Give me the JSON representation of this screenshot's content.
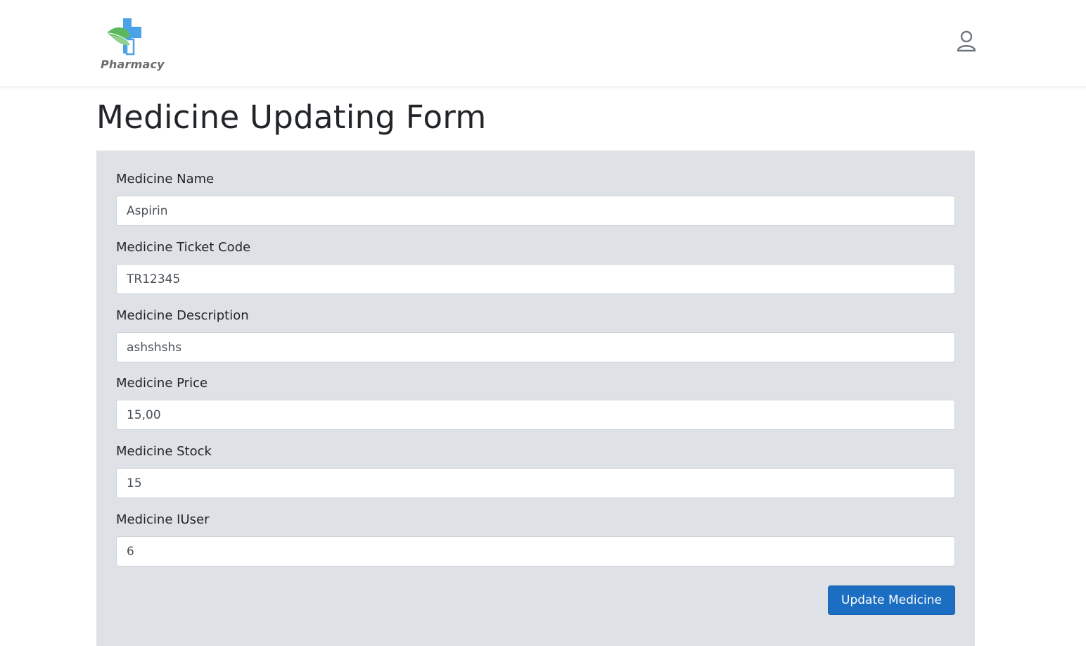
{
  "brand": {
    "logo_text": "Pharmacy",
    "logo_icon": "pharmacy-cross-leaf-icon",
    "colors": {
      "cross": "#4aa3e8",
      "leaf": "#5cb85c"
    }
  },
  "header": {
    "user_icon": "user-icon"
  },
  "page": {
    "title": "Medicine Updating Form"
  },
  "form": {
    "fields": [
      {
        "label": "Medicine Name",
        "value": "Aspirin"
      },
      {
        "label": "Medicine Ticket Code",
        "value": "TR12345"
      },
      {
        "label": "Medicine Description",
        "value": "ashshshs"
      },
      {
        "label": "Medicine Price",
        "value": "15,00"
      },
      {
        "label": "Medicine Stock",
        "value": "15"
      },
      {
        "label": "Medicine IUser",
        "value": "6"
      }
    ],
    "submit_label": "Update Medicine"
  },
  "colors": {
    "panel_bg": "#dee1e6",
    "primary": "#1b6ec2"
  }
}
